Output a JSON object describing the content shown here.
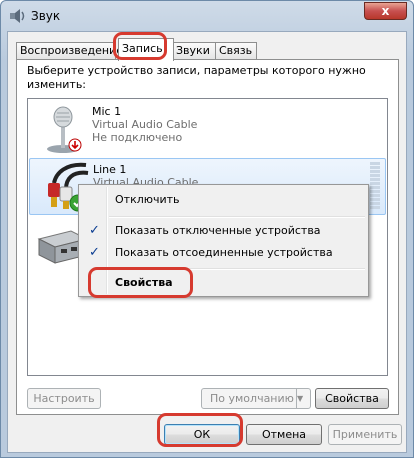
{
  "window": {
    "title": "Звук",
    "close_glyph": "x"
  },
  "tabs": [
    {
      "label": "Воспроизведение",
      "active": false
    },
    {
      "label": "Запись",
      "active": true
    },
    {
      "label": "Звуки",
      "active": false
    },
    {
      "label": "Связь",
      "active": false
    }
  ],
  "panel": {
    "description": "Выберите устройство записи, параметры которого нужно изменить:"
  },
  "devices": [
    {
      "name": "Mic 1",
      "driver": "Virtual Audio Cable",
      "status": "Не подключено",
      "icon": "microphone-icon",
      "badge": "disconnected-arrow-icon"
    },
    {
      "name": "Line 1",
      "driver": "Virtual Audio Cable",
      "status": "",
      "icon": "line-in-cable-icon",
      "badge": "default-device-check-icon"
    },
    {
      "name": "",
      "driver": "",
      "status": "",
      "icon": "sound-card-icon"
    }
  ],
  "context_menu": {
    "items": [
      {
        "label": "Отключить",
        "checked": false
      },
      {
        "label": "Показать отключенные устройства",
        "checked": true
      },
      {
        "label": "Показать отсоединенные устройства",
        "checked": true
      },
      {
        "label": "Свойства",
        "checked": false,
        "bold": true
      }
    ],
    "check_glyph": "✓"
  },
  "panel_buttons": {
    "configure": "Настроить",
    "set_default": "По умолчанию",
    "properties": "Свойства",
    "dropdown_glyph": "▼"
  },
  "dialog_buttons": {
    "ok": "ОК",
    "cancel": "Отмена",
    "apply": "Применить"
  },
  "colors": {
    "highlight": "#d63a2f",
    "selection_border": "#9ac6f3",
    "check": "#0b3d91"
  }
}
